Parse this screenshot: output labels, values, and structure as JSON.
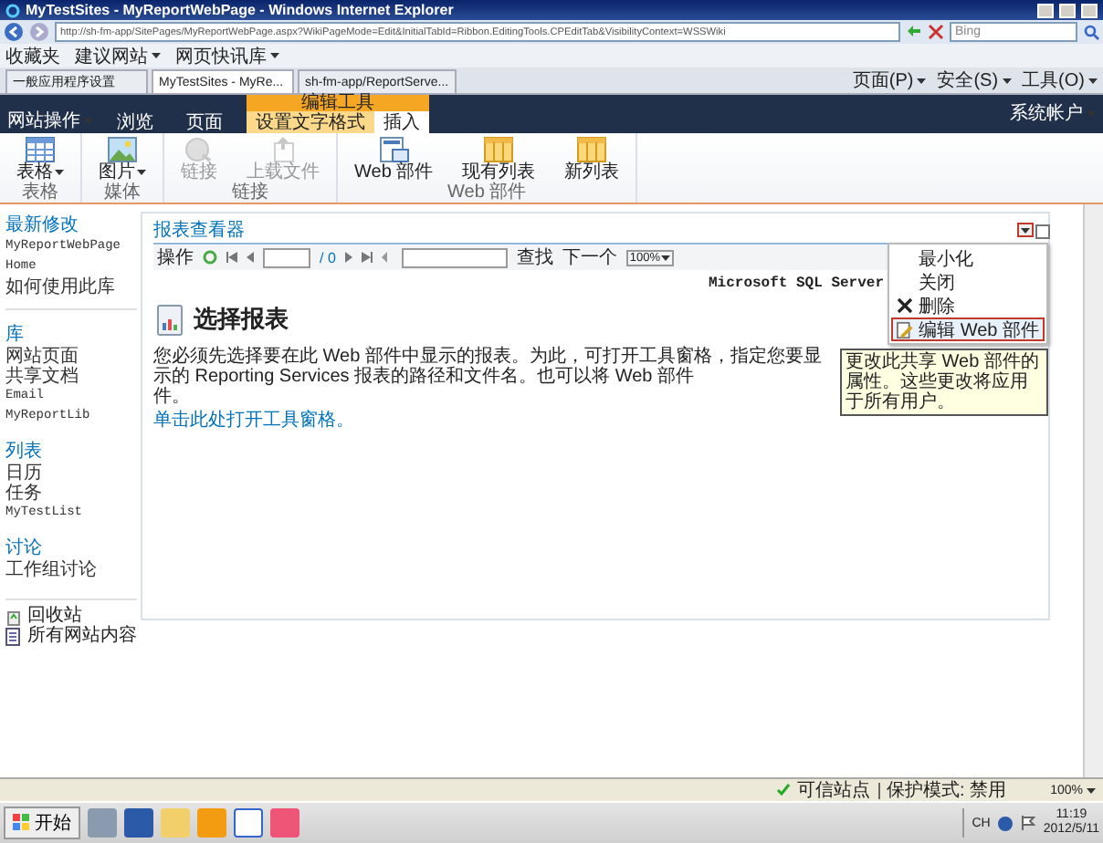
{
  "window": {
    "title": "MyTestSites - MyReportWebPage - Windows Internet Explorer"
  },
  "address_bar": {
    "url": "http://sh-fm-app/SitePages/MyReportWebPage.aspx?WikiPageMode=Edit&InitialTabId=Ribbon.EditingTools.CPEditTab&VisibilityContext=WSSWiki",
    "search_placeholder": "Bing"
  },
  "favorites_bar": {
    "label": "收藏夹",
    "links": [
      "建议网站",
      "网页快讯库"
    ]
  },
  "browser_tabs": [
    {
      "label": "一般应用程序设置",
      "selected": false
    },
    {
      "label": "MyTestSites - MyRe...",
      "selected": true
    },
    {
      "label": "sh-fm-app/ReportServe...",
      "selected": false
    }
  ],
  "command_bar": [
    "页面(P)",
    "安全(S)",
    "工具(O)"
  ],
  "ribbon": {
    "site_actions": "网站操作",
    "context_group": "编辑工具",
    "user": "系统帐户",
    "tabs": [
      {
        "label": "浏览",
        "selected": false,
        "kind": "normal"
      },
      {
        "label": "页面",
        "selected": false,
        "kind": "normal"
      },
      {
        "label": "设置文字格式",
        "selected": false,
        "kind": "context"
      },
      {
        "label": "插入",
        "selected": true,
        "kind": "context"
      }
    ],
    "groups": [
      {
        "label": "表格",
        "buttons": [
          {
            "label": "表格",
            "kind": "table",
            "dropdown": true,
            "disabled": false
          }
        ]
      },
      {
        "label": "媒体",
        "buttons": [
          {
            "label": "图片",
            "kind": "picture",
            "dropdown": true,
            "disabled": false
          }
        ]
      },
      {
        "label": "链接",
        "buttons": [
          {
            "label": "链接",
            "kind": "link",
            "dropdown": false,
            "disabled": true
          },
          {
            "label": "上载文件",
            "kind": "upload",
            "dropdown": false,
            "disabled": true
          }
        ]
      },
      {
        "label": "Web 部件",
        "buttons": [
          {
            "label": "Web 部件",
            "kind": "webpart",
            "dropdown": false,
            "disabled": false
          },
          {
            "label": "现有列表",
            "kind": "list",
            "dropdown": false,
            "disabled": false
          },
          {
            "label": "新列表",
            "kind": "list",
            "dropdown": false,
            "disabled": false
          }
        ]
      }
    ]
  },
  "quick_launch": {
    "sections": [
      {
        "heading": "最新修改",
        "items": [
          "MyReportWebPage",
          "Home",
          "如何使用此库"
        ]
      },
      {
        "heading": "库",
        "items": [
          "网站页面",
          "共享文档",
          "Email",
          "MyReportLib"
        ]
      },
      {
        "heading": "列表",
        "items": [
          "日历",
          "任务",
          "MyTestList"
        ]
      },
      {
        "heading": "讨论",
        "items": [
          "工作组讨论"
        ]
      }
    ],
    "footer": [
      {
        "label": "回收站",
        "kind": "recycle"
      },
      {
        "label": "所有网站内容",
        "kind": "content"
      }
    ]
  },
  "web_part": {
    "title": "报表查看器",
    "actions_label": "操作",
    "page_total": "/ 0",
    "find_label": "查找",
    "next_label": "下一个",
    "zoom": "100%",
    "brand": "Microsoft SQL Server",
    "heading": "选择报表",
    "message": "您必须先选择要在此 Web 部件中显示的报表。为此，可打开工具窗格，指定您要显示的 Reporting Services 报表的路径和文件名。也可以将 Web 部件",
    "message_tail": "件。",
    "link": "单击此处打开工具窗格。",
    "checked": false,
    "menu": [
      {
        "label": "最小化",
        "selected": false,
        "kind": "plain"
      },
      {
        "label": "关闭",
        "selected": false,
        "kind": "plain"
      },
      {
        "label": "删除",
        "selected": false,
        "kind": "delete"
      },
      {
        "label": "编辑 Web 部件",
        "selected": true,
        "kind": "edit"
      }
    ],
    "tooltip": "更改此共享 Web 部件的属性。这些更改将应用于所有用户。"
  },
  "status_bar": {
    "zone": "可信站点",
    "protected_mode": "保护模式: 禁用",
    "zoom": "100%"
  },
  "taskbar": {
    "start": "开始",
    "language": "CH",
    "time": "11:19",
    "date": "2012/5/11"
  }
}
